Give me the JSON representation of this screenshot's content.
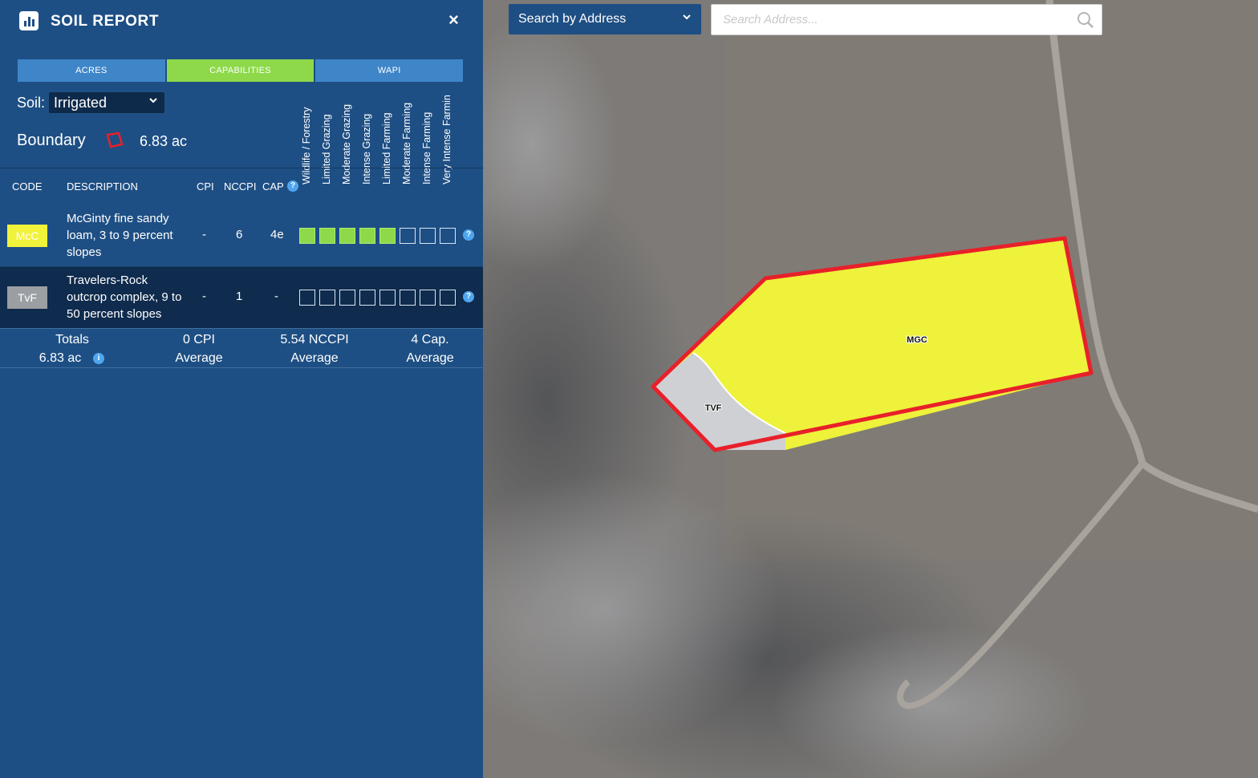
{
  "header": {
    "title": "SOIL REPORT",
    "close": "×"
  },
  "tabs": [
    "ACRES",
    "CAPABILITIES",
    "WAPI"
  ],
  "active_tab": "CAPABILITIES",
  "soil": {
    "label": "Soil:",
    "value": "Irrigated"
  },
  "boundary": {
    "label": "Boundary",
    "acres": "6.83 ac"
  },
  "capability_headers": [
    "Wildlife / Forestry",
    "Limited Grazing",
    "Moderate Grazing",
    "Intense Grazing",
    "Limited Farming",
    "Moderate Farming",
    "Intense Farming",
    "Very Intense Farmin"
  ],
  "columns": {
    "code": "CODE",
    "description": "DESCRIPTION",
    "cpi": "CPI",
    "nccpi": "NCCPI",
    "cap": "CAP",
    "help": "?"
  },
  "rows": [
    {
      "code": "McC",
      "code_color": "#f1f23a",
      "description": "McGinty fine sandy loam, 3 to 9 percent slopes",
      "cpi": "-",
      "nccpi": "6",
      "cap": "4e",
      "capabilities_filled": 5,
      "help": "?"
    },
    {
      "code": "TvF",
      "code_color": "#9b9ea3",
      "description": "Travelers-Rock outcrop complex, 9 to 50 percent slopes",
      "cpi": "-",
      "nccpi": "1",
      "cap": "-",
      "capabilities_filled": 0,
      "help": "?"
    }
  ],
  "totals": {
    "label": "Totals",
    "acres": "6.83 ac",
    "info": "i",
    "cpi": "0 CPI",
    "cpi_sub": "Average",
    "nccpi": "5.54 NCCPI",
    "nccpi_sub": "Average",
    "cap": "4 Cap.",
    "cap_sub": "Average"
  },
  "map": {
    "address_mode": "Search by Address",
    "search_placeholder": "Search Address...",
    "labels": {
      "mcc": "MGC",
      "tvf": "TVF"
    },
    "colors": {
      "boundary": "#e8202a",
      "mcc_fill": "#eef23a",
      "tvf_fill": "#cfd0d4"
    }
  }
}
